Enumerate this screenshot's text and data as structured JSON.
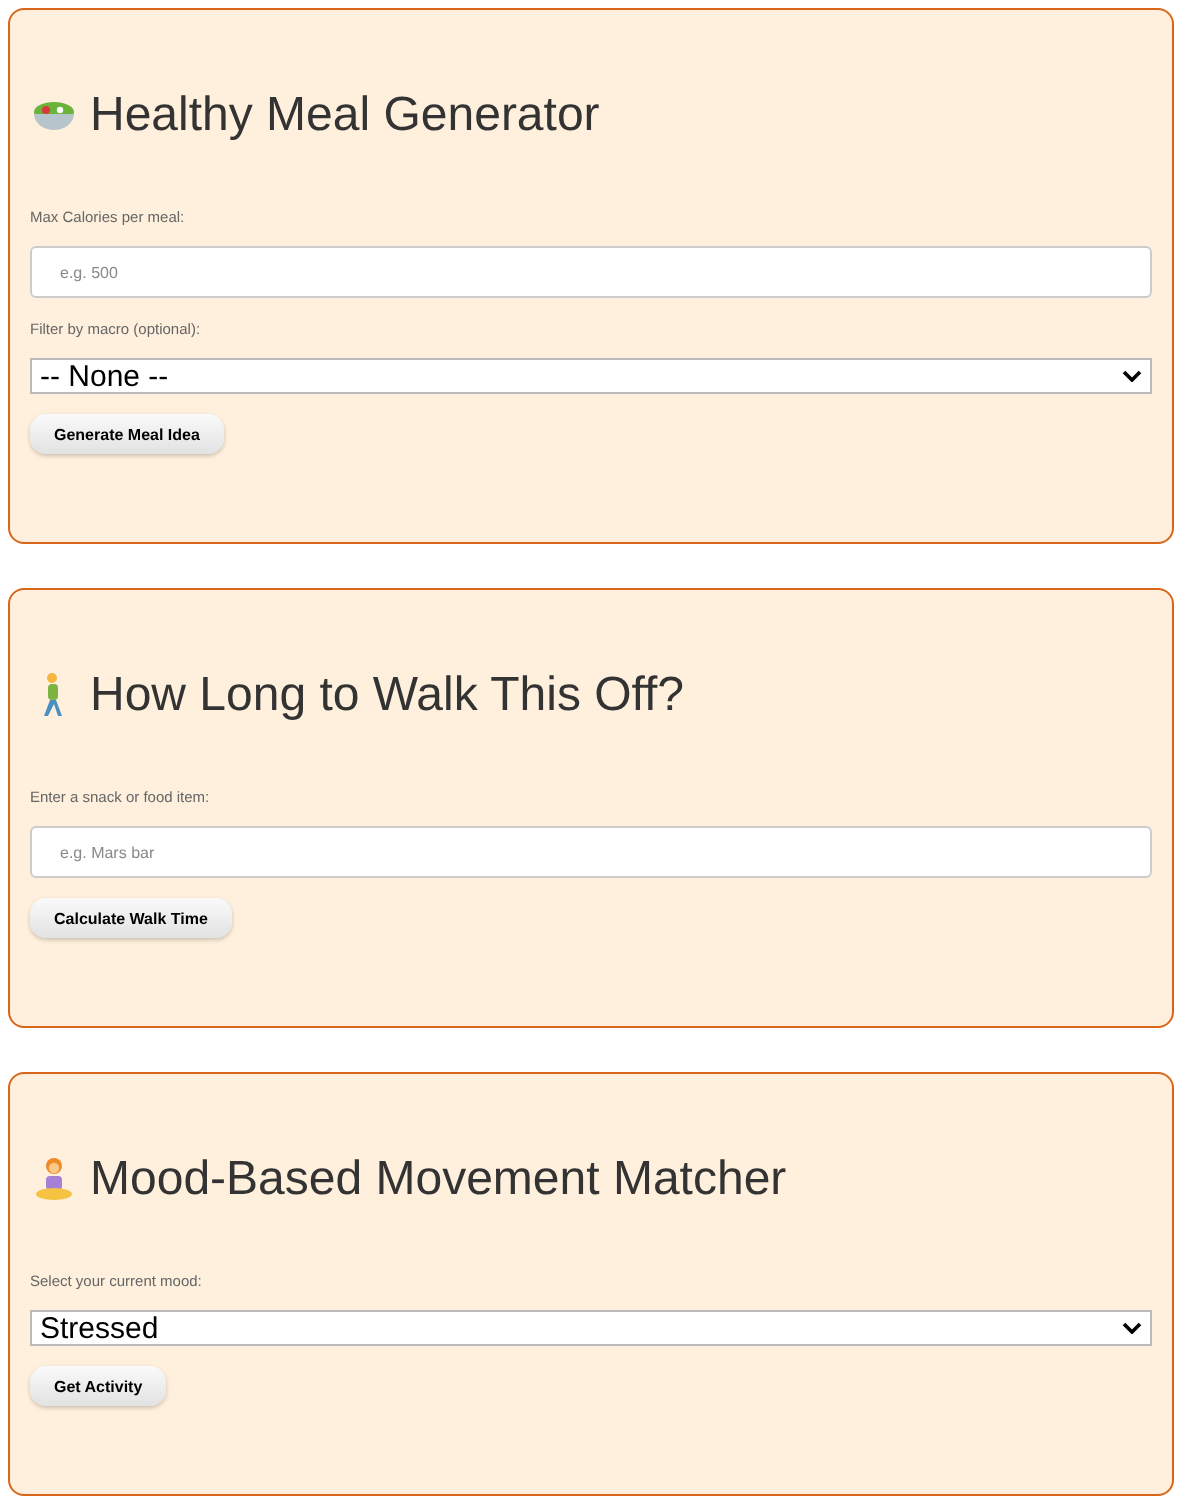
{
  "cards": [
    {
      "kind": "salad",
      "title": "Healthy Meal Generator",
      "fields": [
        {
          "kind": "input",
          "label": "Max Calories per meal:",
          "placeholder": "e.g. 500"
        },
        {
          "kind": "select",
          "label": "Filter by macro (optional):",
          "value": "-- None --"
        }
      ],
      "button": "Generate Meal Idea"
    },
    {
      "kind": "walker",
      "title": "How Long to Walk This Off?",
      "fields": [
        {
          "kind": "input",
          "label": "Enter a snack or food item:",
          "placeholder": "e.g. Mars bar"
        }
      ],
      "button": "Calculate Walk Time"
    },
    {
      "kind": "yoga",
      "title": "Mood-Based Movement Matcher",
      "fields": [
        {
          "kind": "select",
          "label": "Select your current mood:",
          "value": "Stressed"
        }
      ],
      "button": "Get Activity"
    }
  ]
}
